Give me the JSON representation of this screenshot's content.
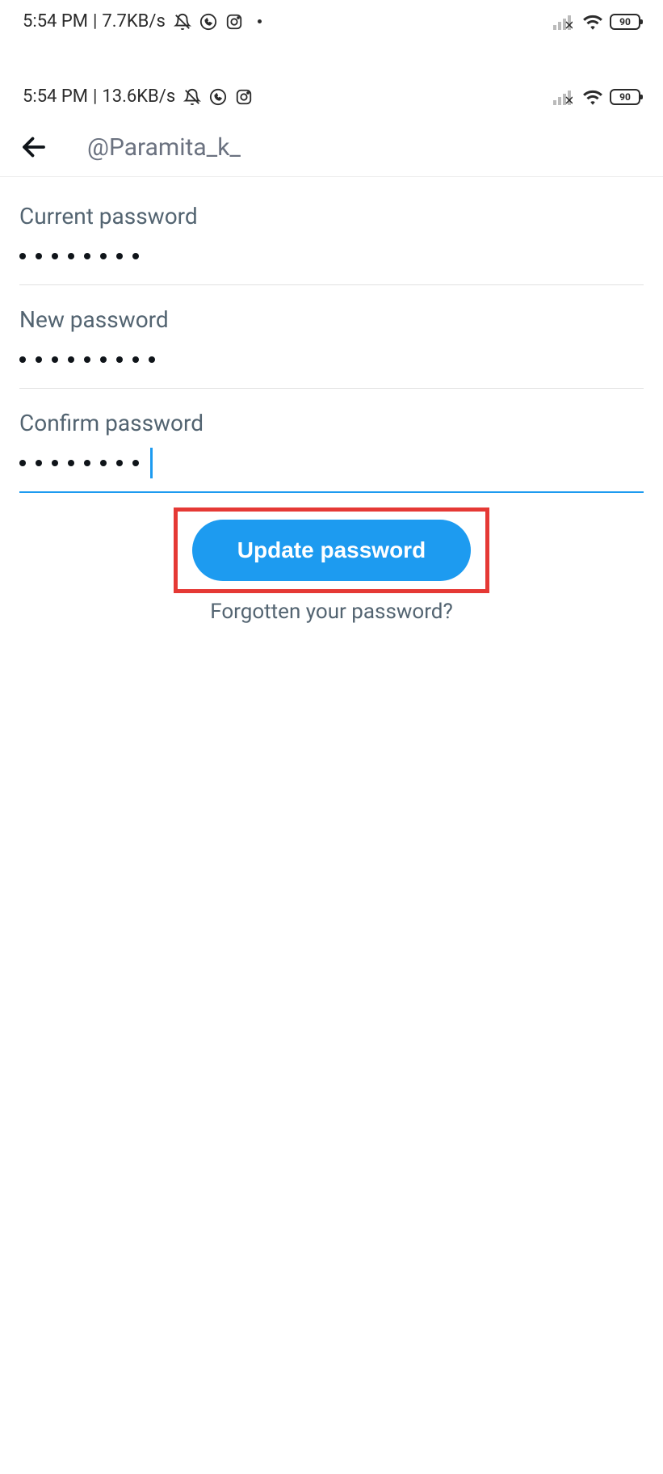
{
  "status_bar_outer": {
    "time": "5:54 PM",
    "speed": "7.7KB/s",
    "battery": "90"
  },
  "status_bar_inner": {
    "time": "5:54 PM",
    "speed": "13.6KB/s",
    "battery": "90"
  },
  "app_bar": {
    "username": "@Paramita_k_"
  },
  "fields": {
    "current_label": "Current password",
    "current_value": "••••••••",
    "new_label": "New password",
    "new_value": "•••••••••",
    "confirm_label": "Confirm password",
    "confirm_value": "••••••••"
  },
  "actions": {
    "update_label": "Update password",
    "forgot_label": "Forgotten your password?"
  }
}
